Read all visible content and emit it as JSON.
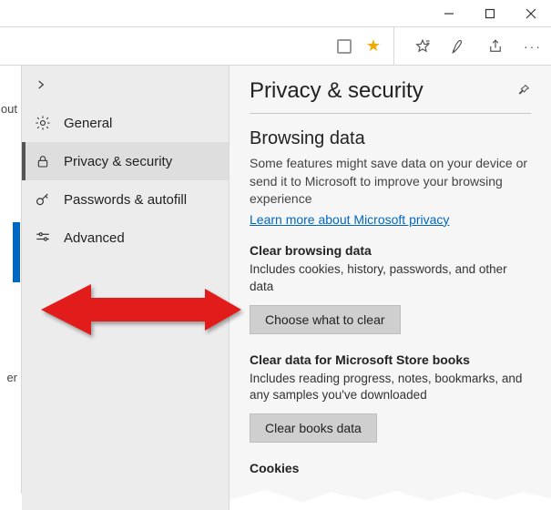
{
  "sidebar": {
    "items": [
      {
        "label": "General"
      },
      {
        "label": "Privacy & security"
      },
      {
        "label": "Passwords & autofill"
      },
      {
        "label": "Advanced"
      }
    ]
  },
  "main": {
    "title": "Privacy & security",
    "browsing": {
      "heading": "Browsing data",
      "description": "Some features might save data on your device or send it to Microsoft to improve your browsing experience",
      "link": "Learn more about Microsoft privacy"
    },
    "clear": {
      "heading": "Clear browsing data",
      "description": "Includes cookies, history, passwords, and other data",
      "button": "Choose what to clear"
    },
    "books": {
      "heading": "Clear data for Microsoft Store books",
      "description": "Includes reading progress, notes, bookmarks, and any samples you've downloaded",
      "button": "Clear books data"
    },
    "cookies": {
      "heading": "Cookies"
    }
  },
  "left_fragments": {
    "a": "out",
    "b": "er"
  }
}
